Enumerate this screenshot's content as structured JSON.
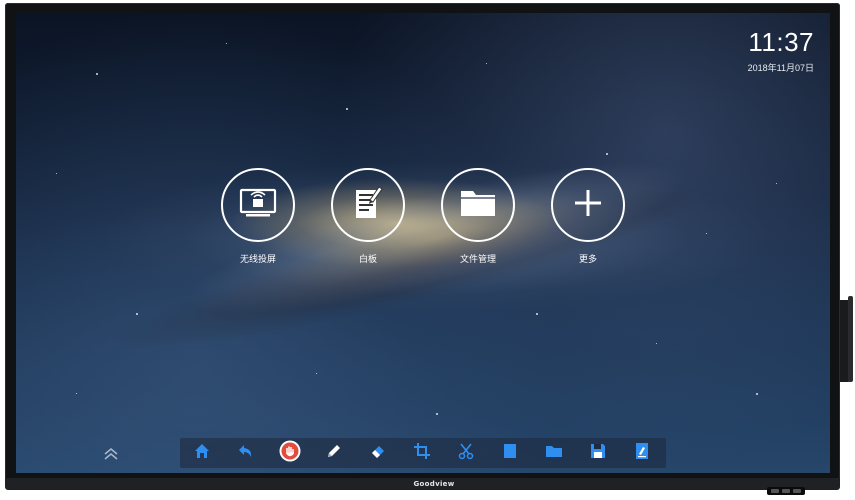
{
  "device": {
    "brand": "Goodview"
  },
  "clock": {
    "time": "11:37",
    "date": "2018年11月07日"
  },
  "apps": [
    {
      "label": "无线投屏",
      "icon": "wireless-screen-cast-icon"
    },
    {
      "label": "白板",
      "icon": "whiteboard-icon"
    },
    {
      "label": "文件管理",
      "icon": "folder-icon"
    },
    {
      "label": "更多",
      "icon": "plus-icon"
    }
  ],
  "toolbar": {
    "tools": [
      "home-icon",
      "undo-icon",
      "hand-stop-icon",
      "pen-icon",
      "eraser-icon",
      "crop-icon",
      "scissors-icon",
      "blank-page-icon",
      "folder-icon",
      "save-icon",
      "note-icon"
    ]
  },
  "colors": {
    "toolbar_icon": "#2f8ff0",
    "stop_button": "#e24c3c",
    "text": "#ffffff"
  }
}
